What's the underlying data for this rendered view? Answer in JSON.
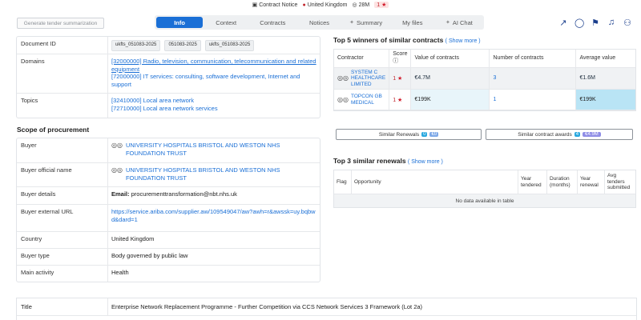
{
  "topbar": {
    "contract_notice": "Contract Notice",
    "country": "United Kingdom",
    "value": "28M",
    "rank": "1"
  },
  "header": {
    "summarize_button": "Generate tender summarization",
    "tabs": [
      "Info",
      "Context",
      "Contracts",
      "Notices",
      "Summary",
      "My files",
      "AI Chat"
    ],
    "active_tab": "Info"
  },
  "details": {
    "document_id_label": "Document ID",
    "document_ids": [
      "ukfts_051083-2025",
      "051083-2025",
      "ukfts_051083-2025"
    ],
    "domains_label": "Domains",
    "domain_1": "[32000000] Radio, television, communication, telecommunication and related equipment",
    "domain_2": "[72000000] IT services: consulting, software development, Internet and support",
    "topics_label": "Topics",
    "topic_1": "[32410000] Local area network",
    "topic_2": "[72710000] Local area network services"
  },
  "scope": {
    "title": "Scope of procurement",
    "buyer_label": "Buyer",
    "buyer": "UNIVERSITY HOSPITALS BRISTOL AND WESTON NHS FOUNDATION TRUST",
    "buyer_official_label": "Buyer official name",
    "buyer_official": "UNIVERSITY HOSPITALS BRISTOL AND WESTON NHS FOUNDATION TRUST",
    "buyer_details_label": "Buyer details",
    "email_label": "Email:",
    "email": "procurementtransformation@nbt.nhs.uk",
    "buyer_url_label": "Buyer external URL",
    "buyer_url": "https://service.ariba.com/supplier.aw/109549047/aw?awh=r&awssk=uy.bqbwd&dard=1",
    "country_label": "Country",
    "country": "United Kingdom",
    "buyer_type_label": "Buyer type",
    "buyer_type": "Body governed by public law",
    "main_activity_label": "Main activity",
    "main_activity": "Health"
  },
  "winners": {
    "title": "Top 5 winners of similar contracts",
    "show_more": "( Show more )",
    "columns": [
      "Contractor",
      "Score",
      "Value of contracts",
      "Number of contracts",
      "Average value"
    ],
    "rows": [
      {
        "contractor": "SYSTEM C HEALTHCARE LIMITED",
        "score": "1",
        "value": "€4.7M",
        "count": "3",
        "average": "€1.6M"
      },
      {
        "contractor": "TOPCON GB MEDICAL",
        "score": "1",
        "value": "€199K",
        "count": "1",
        "average": "€199K"
      }
    ]
  },
  "similar": {
    "renewals_label": "Similar Renewals",
    "renewals_count": "0",
    "renewals_amount": "€0",
    "awards_label": "Similar contract awards",
    "awards_count": "4",
    "awards_amount": "€4.9M"
  },
  "renewals": {
    "title": "Top 3 similar renewals",
    "show_more": "( Show more )",
    "columns": [
      "Flag",
      "Opportunity",
      "Year tendered",
      "Duration (months)",
      "Year renewal",
      "Avg tenders submitted"
    ],
    "empty": "No data available in table"
  },
  "bottom": {
    "title_label": "Title",
    "title_value": "Enterprise Network Replacement Programme - Further Competition via CCS Network Services 3 Framework (Lot 2a)"
  },
  "icons": [
    "contract-notice-icon",
    "flag-uk-icon",
    "coin-icon",
    "star-icon",
    "share-icon",
    "chat-icon",
    "flag-icon",
    "bell-icon",
    "add-user-icon"
  ]
}
